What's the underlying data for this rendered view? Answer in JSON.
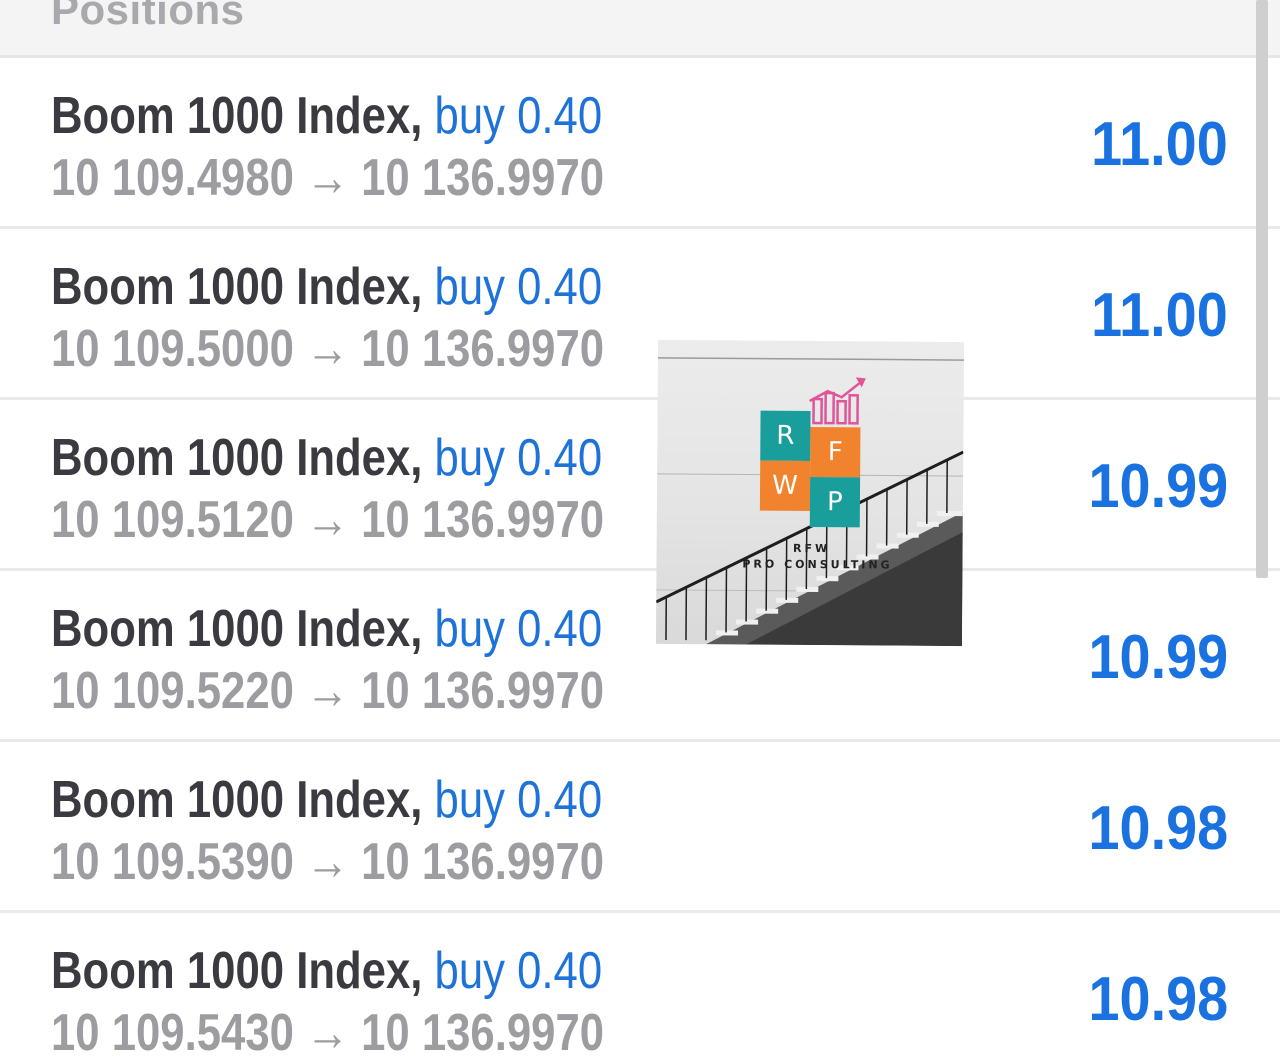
{
  "header": {
    "title": "Positions"
  },
  "positions": [
    {
      "symbol": "Boom 1000 Index,",
      "direction": "buy",
      "volume": "0.40",
      "open_price": "10 109.4980",
      "arrow": "→",
      "current_price": "10 136.9970",
      "profit": "11.00"
    },
    {
      "symbol": "Boom 1000 Index,",
      "direction": "buy",
      "volume": "0.40",
      "open_price": "10 109.5000",
      "arrow": "→",
      "current_price": "10 136.9970",
      "profit": "11.00"
    },
    {
      "symbol": "Boom 1000 Index,",
      "direction": "buy",
      "volume": "0.40",
      "open_price": "10 109.5120",
      "arrow": "→",
      "current_price": "10 136.9970",
      "profit": "10.99"
    },
    {
      "symbol": "Boom 1000 Index,",
      "direction": "buy",
      "volume": "0.40",
      "open_price": "10 109.5220",
      "arrow": "→",
      "current_price": "10 136.9970",
      "profit": "10.99"
    },
    {
      "symbol": "Boom 1000 Index,",
      "direction": "buy",
      "volume": "0.40",
      "open_price": "10 109.5390",
      "arrow": "→",
      "current_price": "10 136.9970",
      "profit": "10.98"
    },
    {
      "symbol": "Boom 1000 Index,",
      "direction": "buy",
      "volume": "0.40",
      "open_price": "10 109.5430",
      "arrow": "→",
      "current_price": "10 136.9970",
      "profit": "10.98"
    }
  ],
  "watermark": {
    "tiles": [
      "R",
      "F",
      "W",
      "P"
    ],
    "line1": "RFW",
    "line2": "PRO CONSULTING",
    "icon": "bar-chart-arrow-icon"
  },
  "colors": {
    "profit": "#1a72e0",
    "direction": "#1e73d8",
    "symbol": "#3a3a40",
    "price": "#9d9da1",
    "tile_teal": "#1a9e9b",
    "tile_orange": "#f2832e",
    "logo_pink": "#e0559a"
  }
}
